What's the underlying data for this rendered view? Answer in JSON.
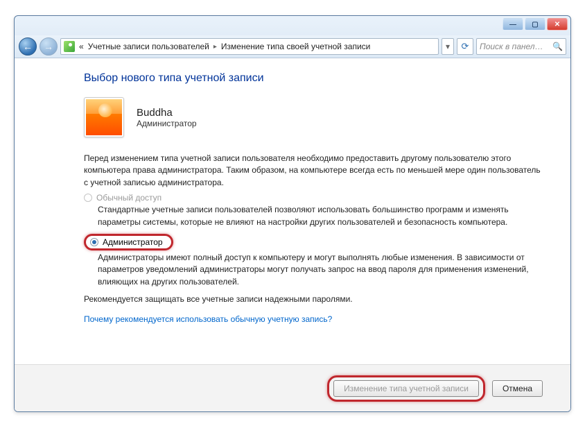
{
  "titlebar": {
    "min": "—",
    "max": "▢",
    "close": "✕"
  },
  "nav": {
    "back": "←",
    "forward": "→",
    "refresh": "⟳",
    "search_placeholder": "Поиск в панел…",
    "search_icon": "🔍"
  },
  "breadcrumb": {
    "left_chevron": "«",
    "items": [
      "Учетные записи пользователей",
      "Изменение типа своей учетной записи"
    ],
    "sep": "▸"
  },
  "page": {
    "title": "Выбор нового типа учетной записи",
    "user_name": "Buddha",
    "user_role": "Администратор",
    "intro": "Перед изменением типа учетной записи пользователя необходимо предоставить другому пользователю этого компьютера права администратора. Таким образом, на компьютере всегда есть по меньшей мере один пользователь с учетной записью администратора.",
    "options": [
      {
        "label": "Обычный доступ",
        "desc": "Стандартные учетные записи пользователей позволяют использовать большинство программ и изменять параметры системы, которые не влияют на настройки других пользователей и безопасность компьютера.",
        "selected": false,
        "disabled": true
      },
      {
        "label": "Администратор",
        "desc": "Администраторы имеют полный доступ к компьютеру и могут выполнять любые изменения. В зависимости от параметров уведомлений администраторы могут получать запрос на ввод пароля для применения изменений, влияющих на других пользователей.",
        "selected": true,
        "disabled": false
      }
    ],
    "recommend": "Рекомендуется защищать все учетные записи надежными паролями.",
    "link": "Почему рекомендуется использовать обычную учетную запись?"
  },
  "footer": {
    "apply": "Изменение типа учетной записи",
    "cancel": "Отмена"
  }
}
